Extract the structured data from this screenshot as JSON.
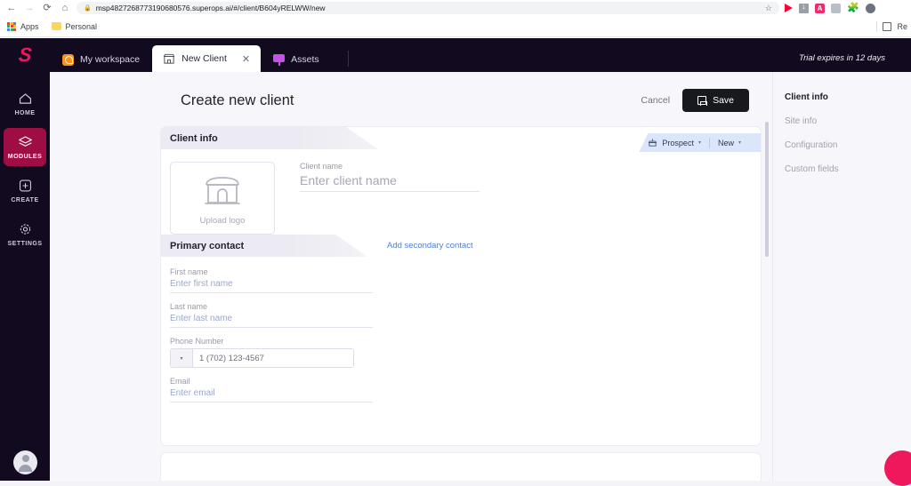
{
  "browser": {
    "nav": {
      "back": "←",
      "forward": "→",
      "reload": "⟳",
      "home": "⌂"
    },
    "url": "msp4827268773190680576.superops.ai/#/client/B604yRELWW/new",
    "lock_icon": "lock-icon",
    "star_icon": "bookmark-star-icon",
    "extensions": [
      "video-extension-icon",
      "download-extension-icon",
      "adblock-extension-icon",
      "screenshot-extension-icon",
      "puzzle-extensions-icon",
      "profile-icon"
    ],
    "bookmarks": [
      {
        "label": "Apps",
        "icon": "apps-grid-icon"
      },
      {
        "label": "Personal",
        "icon": "folder-icon"
      }
    ],
    "reading_list_label": "Re"
  },
  "app": {
    "logo": "superops-logo",
    "tabs": [
      {
        "label": "My workspace",
        "icon": "workspace-icon",
        "active": false,
        "closable": false
      },
      {
        "label": "New Client",
        "icon": "shop-icon",
        "active": true,
        "closable": true
      },
      {
        "label": "Assets",
        "icon": "assets-monitor-icon",
        "active": false,
        "closable": false
      }
    ],
    "tab_close_glyph": "✕",
    "trial_notice": "Trial expires in 12 days"
  },
  "rail": {
    "items": [
      {
        "label": "HOME",
        "icon": "home-icon",
        "active": false
      },
      {
        "label": "MODULES",
        "icon": "modules-layers-icon",
        "active": true
      },
      {
        "label": "CREATE",
        "icon": "create-plus-icon",
        "active": false
      },
      {
        "label": "SETTINGS",
        "icon": "settings-gear-icon",
        "active": false
      }
    ],
    "active_color": "#9e0d43",
    "avatar": "user-avatar"
  },
  "page": {
    "title": "Create new client",
    "cancel_label": "Cancel",
    "save_label": "Save"
  },
  "client_info": {
    "section_title": "Client info",
    "status_pill": {
      "label": "Prospect",
      "icon": "prospect-icon",
      "caret": "▾"
    },
    "stage_pill": {
      "label": "New",
      "caret": "▾"
    },
    "logo_upload": {
      "label": "Upload logo",
      "icon": "shop-storefront-icon"
    },
    "client_name": {
      "label": "Client name",
      "value": "",
      "placeholder": "Enter client name"
    }
  },
  "primary_contact": {
    "section_title": "Primary contact",
    "add_secondary_label": "Add secondary contact",
    "fields": [
      {
        "label": "First name",
        "value": "",
        "placeholder": "Enter first name"
      },
      {
        "label": "Last name",
        "value": "",
        "placeholder": "Enter last name"
      }
    ],
    "phone": {
      "label": "Phone Number",
      "value": "",
      "placeholder": "1 (702) 123-4567",
      "country_caret": "▾"
    },
    "email": {
      "label": "Email",
      "value": "",
      "placeholder": "Enter email"
    }
  },
  "right_nav": {
    "items": [
      {
        "label": "Client info",
        "active": true
      },
      {
        "label": "Site info",
        "active": false
      },
      {
        "label": "Configuration",
        "active": false
      },
      {
        "label": "Custom fields",
        "active": false
      }
    ]
  },
  "fab": {
    "name": "help-chat-button",
    "color": "#f0185c"
  }
}
